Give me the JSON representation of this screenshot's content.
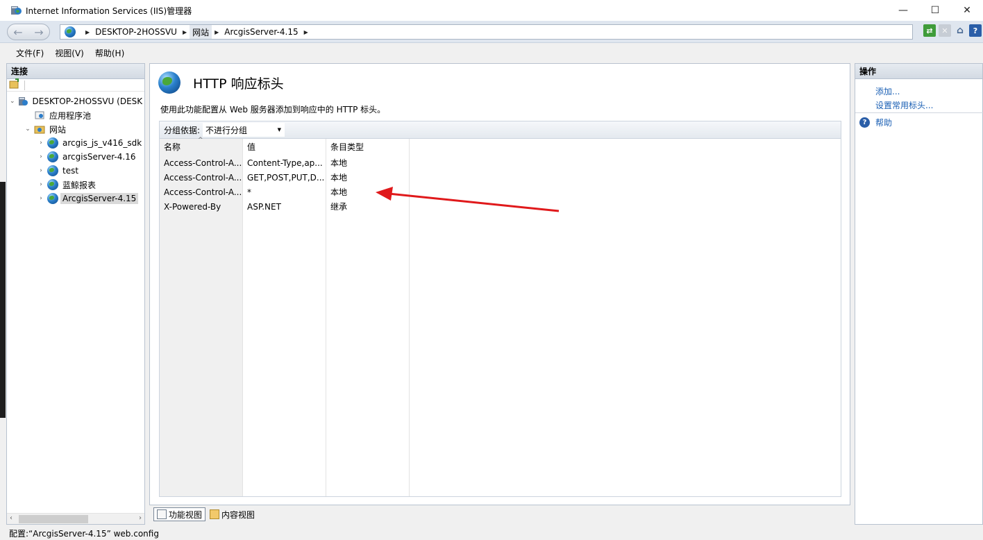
{
  "window": {
    "title": "Internet Information Services (IIS)管理器",
    "minimize": "—",
    "maximize": "☐",
    "close": "✕"
  },
  "address": {
    "breadcrumbs": [
      "DESKTOP-2HOSSVU",
      "网站",
      "ArcgisServer-4.15"
    ]
  },
  "menu": {
    "items": [
      "文件(F)",
      "视图(V)",
      "帮助(H)"
    ]
  },
  "connections": {
    "header": "连接",
    "tree": [
      {
        "label": "DESKTOP-2HOSSVU (DESK",
        "expander": "⌄",
        "icon": "server-icon"
      },
      {
        "label": "应用程序池",
        "expander": "",
        "icon": "app-pool-icon"
      },
      {
        "label": "网站",
        "expander": "⌄",
        "icon": "sites-folder-icon"
      },
      {
        "label": "arcgis_js_v416_sdk",
        "expander": "›",
        "icon": "globe-icon"
      },
      {
        "label": "arcgisServer-4.16",
        "expander": "›",
        "icon": "globe-icon"
      },
      {
        "label": "test",
        "expander": "›",
        "icon": "globe-icon"
      },
      {
        "label": "蓝鲸报表",
        "expander": "›",
        "icon": "globe-icon"
      },
      {
        "label": "ArcgisServer-4.15",
        "expander": "›",
        "icon": "globe-icon"
      }
    ]
  },
  "feature": {
    "title": "HTTP 响应标头",
    "description": "使用此功能配置从 Web 服务器添加到响应中的 HTTP 标头。",
    "group_label": "分组依据:",
    "group_value": "不进行分组",
    "columns": [
      "名称",
      "值",
      "条目类型"
    ],
    "rows": [
      [
        "Access-Control-A...",
        "Content-Type,ap...",
        "本地"
      ],
      [
        "Access-Control-A...",
        "GET,POST,PUT,D...",
        "本地"
      ],
      [
        "Access-Control-A...",
        "*",
        "本地"
      ],
      [
        "X-Powered-By",
        "ASP.NET",
        "继承"
      ]
    ]
  },
  "views": {
    "features_view": "功能视图",
    "content_view": "内容视图"
  },
  "actions": {
    "header": "操作",
    "add": "添加...",
    "set_common": "设置常用标头...",
    "help": "帮助"
  },
  "status": {
    "text": "配置:“ArcgisServer-4.15” web.config"
  },
  "colors": {
    "link": "#1a5fb4",
    "annotation_arrow": "#e0191b"
  }
}
